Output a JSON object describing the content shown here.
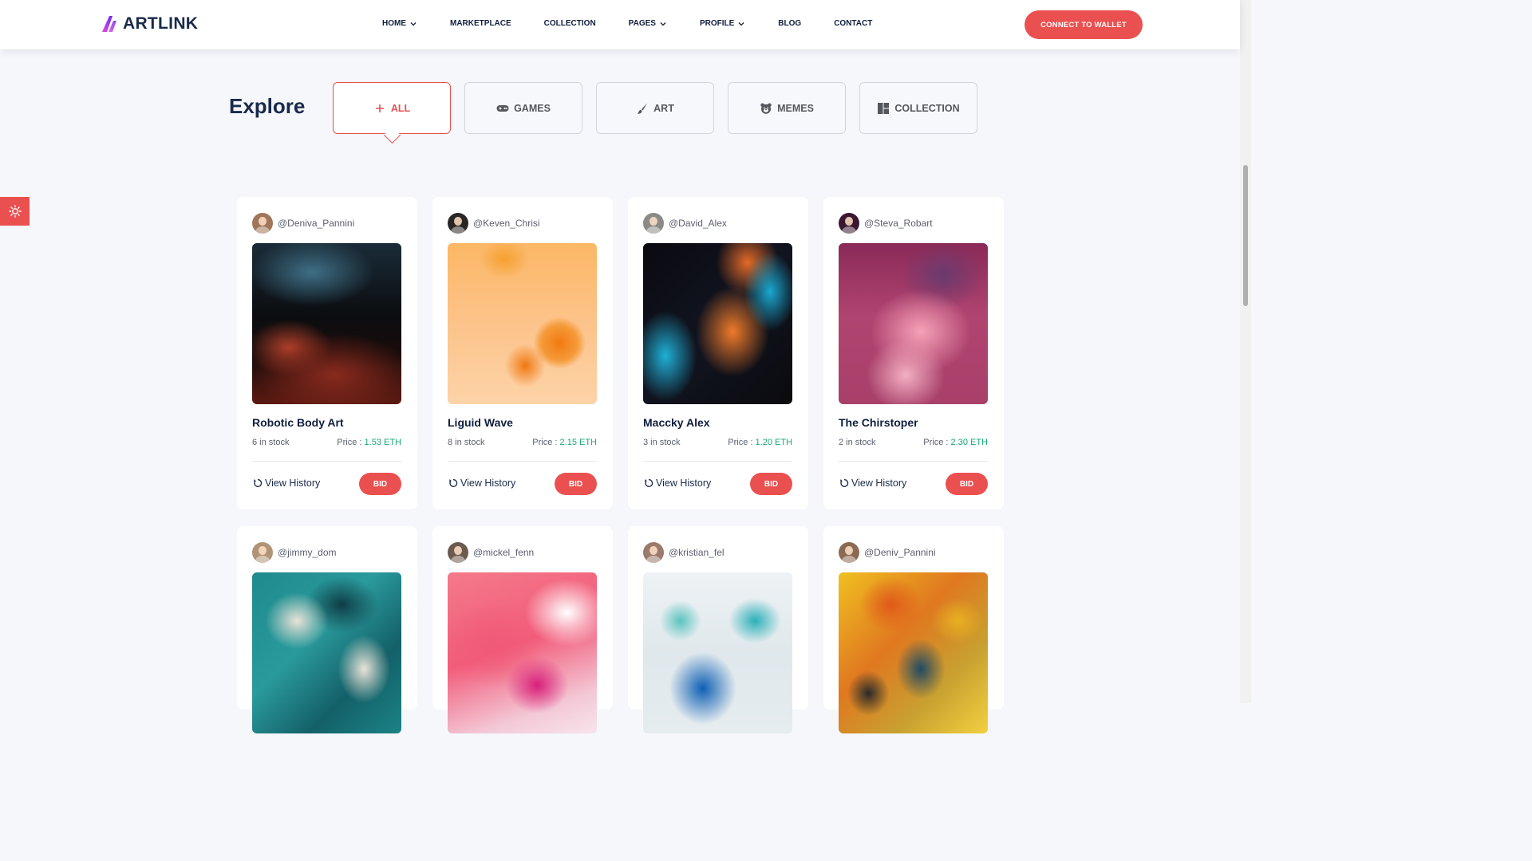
{
  "brand": {
    "name": "ARTLINK"
  },
  "nav": [
    {
      "label": "HOME",
      "dropdown": true
    },
    {
      "label": "MARKETPLACE",
      "dropdown": false
    },
    {
      "label": "COLLECTION",
      "dropdown": false
    },
    {
      "label": "PAGES",
      "dropdown": true
    },
    {
      "label": "PROFILE",
      "dropdown": true
    },
    {
      "label": "BLOG",
      "dropdown": false
    },
    {
      "label": "CONTACT",
      "dropdown": false
    }
  ],
  "connect_button": "CONNECT TO WALLET",
  "explore": {
    "title": "Explore",
    "filters": [
      {
        "label": "ALL",
        "icon": "plus-icon",
        "active": true
      },
      {
        "label": "GAMES",
        "icon": "gamepad-icon",
        "active": false
      },
      {
        "label": "ART",
        "icon": "brush-icon",
        "active": false
      },
      {
        "label": "MEMES",
        "icon": "bear-face-icon",
        "active": false
      },
      {
        "label": "COLLECTION",
        "icon": "grid-icon",
        "active": false
      }
    ]
  },
  "card_labels": {
    "price_prefix": "Price : ",
    "view_history": "View History",
    "bid": "BID"
  },
  "cards": [
    {
      "owner": "@Deniva_Pannini",
      "title": "Robotic Body Art",
      "stock": "6 in stock",
      "price": "1.53 ETH"
    },
    {
      "owner": "@Keven_Chrisi",
      "title": "Liguid Wave",
      "stock": "8 in stock",
      "price": "2.15 ETH"
    },
    {
      "owner": "@David_Alex",
      "title": "Maccky Alex",
      "stock": "3 in stock",
      "price": "1.20 ETH"
    },
    {
      "owner": "@Steva_Robart",
      "title": "The Chirstoper",
      "stock": "2 in stock",
      "price": "2.30 ETH"
    },
    {
      "owner": "@jimmy_dom"
    },
    {
      "owner": "@mickel_fenn"
    },
    {
      "owner": "@kristian_fel"
    },
    {
      "owner": "@Deniv_Pannini"
    }
  ],
  "colors": {
    "accent": "#eb5050",
    "price": "#17a874",
    "heading": "#1a2a4a",
    "background": "#f5f7fb"
  }
}
